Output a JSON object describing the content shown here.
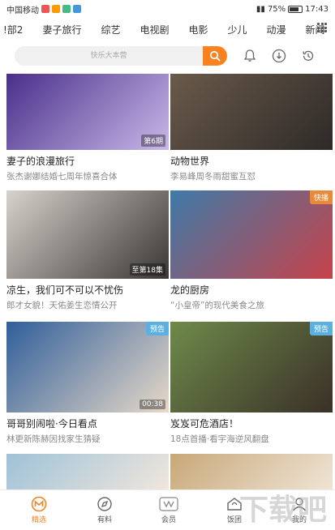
{
  "status_bar": {
    "carrier": "中国移动",
    "battery_percent": "75%",
    "time": "17:43"
  },
  "tabs": [
    "!部2",
    "妻子旅行",
    "综艺",
    "电视剧",
    "电影",
    "少儿",
    "动漫",
    "新闻"
  ],
  "search": {
    "placeholder": "快乐大本营"
  },
  "cards": [
    {
      "title": "妻子的浪漫旅行",
      "subtitle": "张杰谢娜结婚七周年惊喜合体",
      "tag": "第6期",
      "badge": "",
      "colors": [
        "#4a2f8a",
        "#c9b8e8"
      ]
    },
    {
      "title": "动物世界",
      "subtitle": "李易峰周冬雨甜蜜互怼",
      "tag": "",
      "badge": "",
      "colors": [
        "#6a5a4a",
        "#2e2a28"
      ]
    },
    {
      "title": "凉生，我们可不可以不忧伤",
      "subtitle": "郎才女貌！天佑姜生恋情公开",
      "tag": "至第18集",
      "badge": "",
      "colors": [
        "#d8d2cc",
        "#3a3634"
      ]
    },
    {
      "title": "龙的厨房",
      "subtitle": "“小皇帝”的现代美食之旅",
      "tag": "",
      "badge": "快播",
      "colors": [
        "#3f7aa8",
        "#c7424a"
      ]
    },
    {
      "title": "哥哥别闹啦·今日看点",
      "subtitle": "林更新陈赫因找家生猜疑",
      "tag": "00:38",
      "badge": "预告",
      "colors": [
        "#2f5f9a",
        "#e8d9c8"
      ]
    },
    {
      "title": "岌岌可危酒店！",
      "subtitle": "18点首播·看宇海逆风翻盘",
      "tag": "",
      "badge": "预告",
      "colors": [
        "#6e8a4a",
        "#3a3028"
      ]
    },
    {
      "title": "",
      "subtitle": "",
      "tag": "",
      "badge": "",
      "colors": [
        "#9fc2d8",
        "#f0e6dc"
      ]
    },
    {
      "title": "",
      "subtitle": "",
      "tag": "",
      "badge": "",
      "colors": [
        "#c8a878",
        "#efe4d6"
      ]
    }
  ],
  "bottom_nav": [
    {
      "label": "精选",
      "icon": "home-featured-icon",
      "active": true
    },
    {
      "label": "有料",
      "icon": "compass-icon",
      "active": false
    },
    {
      "label": "会员",
      "icon": "member-icon",
      "active": false
    },
    {
      "label": "饭团",
      "icon": "fan-group-icon",
      "active": false
    },
    {
      "label": "我的",
      "icon": "profile-icon",
      "active": false
    }
  ],
  "watermark_text": "下载吧",
  "accent_color": "#f7821f",
  "badge_color": "#e98a3a",
  "preview_badge_color": "#5bb0e0"
}
